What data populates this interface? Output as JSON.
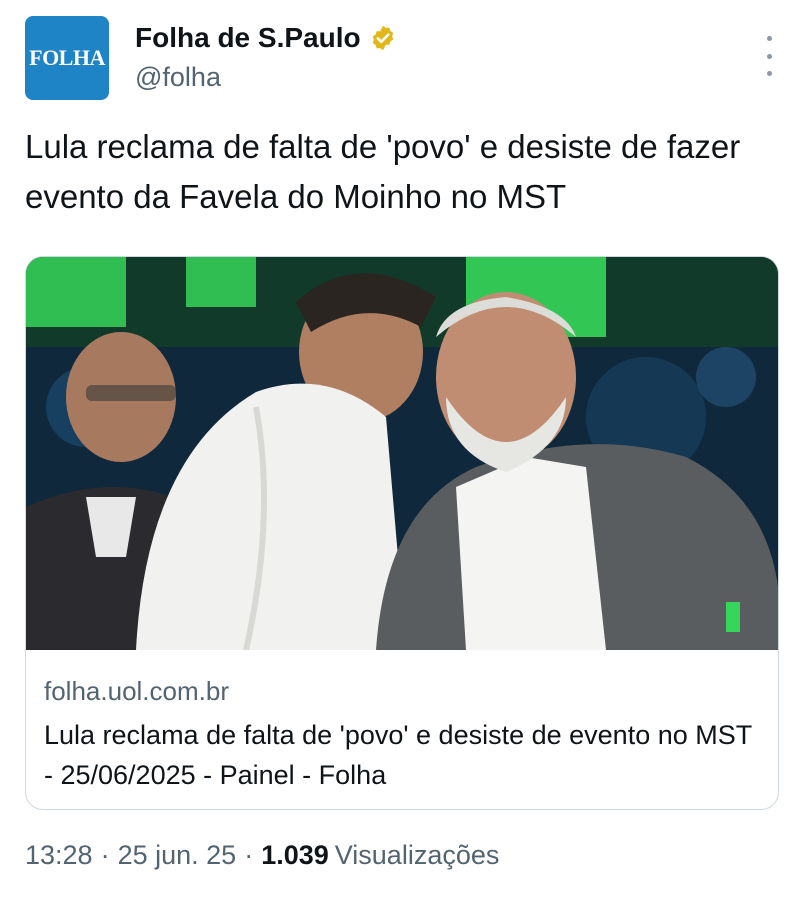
{
  "author": {
    "avatar_text": "FOLHA",
    "display_name": "Folha de S.Paulo",
    "handle": "@folha",
    "verified_badge_color": "#e2b719"
  },
  "tweet": {
    "text": "Lula reclama de falta de 'povo' e desiste de fazer evento da Favela do Moinho no MST"
  },
  "link_card": {
    "domain": "folha.uol.com.br",
    "title": "Lula reclama de falta de 'povo' e desiste de evento no MST - 25/06/2025 - Painel - Folha",
    "image_icon": "photo-two-men-embracing"
  },
  "meta": {
    "time": "13:28",
    "date": "25 jun. 25",
    "views_count": "1.039",
    "views_label": "Visualizações",
    "separator": "·"
  },
  "colors": {
    "brand_blue": "#1f84c6",
    "text_primary": "#0f1419",
    "text_secondary": "#536471",
    "border": "#cfd9de"
  }
}
